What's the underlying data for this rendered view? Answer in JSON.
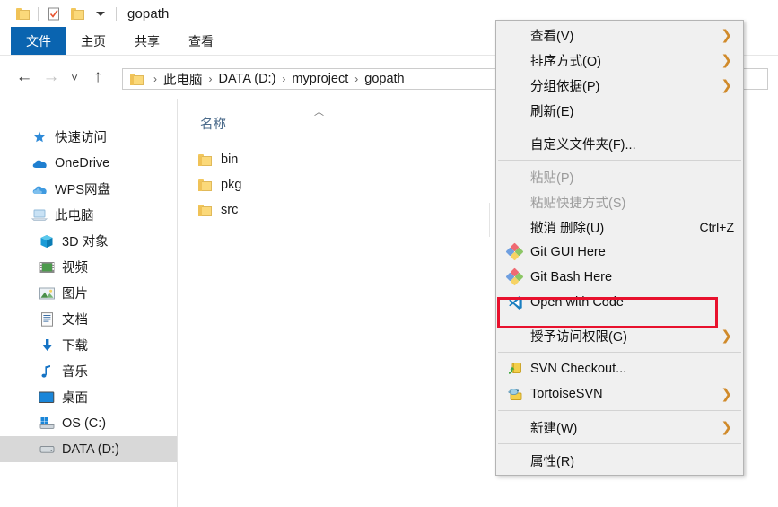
{
  "window": {
    "title": "gopath",
    "quick_access": [
      {
        "name": "folder-icon",
        "label": "folder"
      },
      {
        "name": "properties-icon",
        "label": "properties"
      },
      {
        "name": "new-folder-icon",
        "label": "new folder"
      },
      {
        "name": "customize-dropdown",
        "label": "customize quick access toolbar"
      }
    ]
  },
  "ribbon": {
    "tabs": [
      {
        "label": "文件",
        "active": true
      },
      {
        "label": "主页",
        "active": false
      },
      {
        "label": "共享",
        "active": false
      },
      {
        "label": "查看",
        "active": false
      }
    ],
    "active_color": "#0a64b0"
  },
  "navigation": {
    "back": "←",
    "forward": "→",
    "recent": "˅",
    "up": "↑",
    "breadcrumb": [
      "此电脑",
      "DATA (D:)",
      "myproject",
      "gopath"
    ],
    "separator": "›"
  },
  "sidebar": {
    "items": [
      {
        "label": "快速访问",
        "icon": "star-icon",
        "indent": false,
        "selected": false
      },
      {
        "label": "OneDrive",
        "icon": "cloud-icon",
        "indent": false,
        "selected": false
      },
      {
        "label": "WPS网盘",
        "icon": "cloud-icon",
        "indent": false,
        "selected": false
      },
      {
        "label": "此电脑",
        "icon": "computer-icon",
        "indent": false,
        "selected": false
      },
      {
        "label": "3D 对象",
        "icon": "3d-objects-icon",
        "indent": true,
        "selected": false
      },
      {
        "label": "视频",
        "icon": "videos-icon",
        "indent": true,
        "selected": false
      },
      {
        "label": "图片",
        "icon": "pictures-icon",
        "indent": true,
        "selected": false
      },
      {
        "label": "文档",
        "icon": "documents-icon",
        "indent": true,
        "selected": false
      },
      {
        "label": "下载",
        "icon": "downloads-icon",
        "indent": true,
        "selected": false
      },
      {
        "label": "音乐",
        "icon": "music-icon",
        "indent": true,
        "selected": false
      },
      {
        "label": "桌面",
        "icon": "desktop-icon",
        "indent": true,
        "selected": false
      },
      {
        "label": "OS (C:)",
        "icon": "drive-os-icon",
        "indent": true,
        "selected": false
      },
      {
        "label": "DATA (D:)",
        "icon": "drive-icon",
        "indent": true,
        "selected": true
      }
    ]
  },
  "filelist": {
    "sort_caret": "︿",
    "columns": [
      "名称"
    ],
    "rows": [
      {
        "name": "bin",
        "icon": "folder-icon"
      },
      {
        "name": "pkg",
        "icon": "folder-icon"
      },
      {
        "name": "src",
        "icon": "folder-icon"
      }
    ]
  },
  "context_menu": {
    "highlight_color": "#e8112d",
    "items": [
      {
        "label": "查看(V)",
        "icon": null,
        "submenu": true,
        "disabled": false,
        "accel": "",
        "separator_after": false
      },
      {
        "label": "排序方式(O)",
        "icon": null,
        "submenu": true,
        "disabled": false,
        "accel": "",
        "separator_after": false
      },
      {
        "label": "分组依据(P)",
        "icon": null,
        "submenu": true,
        "disabled": false,
        "accel": "",
        "separator_after": false
      },
      {
        "label": "刷新(E)",
        "icon": null,
        "submenu": false,
        "disabled": false,
        "accel": "",
        "separator_after": true
      },
      {
        "label": "自定义文件夹(F)...",
        "icon": null,
        "submenu": false,
        "disabled": false,
        "accel": "",
        "separator_after": true
      },
      {
        "label": "粘贴(P)",
        "icon": null,
        "submenu": false,
        "disabled": true,
        "accel": "",
        "separator_after": false
      },
      {
        "label": "粘贴快捷方式(S)",
        "icon": null,
        "submenu": false,
        "disabled": true,
        "accel": "",
        "separator_after": false
      },
      {
        "label": "撤消 删除(U)",
        "icon": null,
        "submenu": false,
        "disabled": false,
        "accel": "Ctrl+Z",
        "separator_after": false
      },
      {
        "label": "Git GUI Here",
        "icon": "git-icon",
        "submenu": false,
        "disabled": false,
        "accel": "",
        "separator_after": false
      },
      {
        "label": "Git Bash Here",
        "icon": "git-icon",
        "submenu": false,
        "disabled": false,
        "accel": "",
        "separator_after": false
      },
      {
        "label": "Open with Code",
        "icon": "vscode-icon",
        "submenu": false,
        "disabled": false,
        "accel": "",
        "separator_after": true,
        "highlighted": true
      },
      {
        "label": "授予访问权限(G)",
        "icon": null,
        "submenu": true,
        "disabled": false,
        "accel": "",
        "separator_after": true
      },
      {
        "label": "SVN Checkout...",
        "icon": "svn-checkout-icon",
        "submenu": false,
        "disabled": false,
        "accel": "",
        "separator_after": false
      },
      {
        "label": "TortoiseSVN",
        "icon": "tortoisesvn-icon",
        "submenu": true,
        "disabled": false,
        "accel": "",
        "separator_after": true
      },
      {
        "label": "新建(W)",
        "icon": null,
        "submenu": true,
        "disabled": false,
        "accel": "",
        "separator_after": true
      },
      {
        "label": "属性(R)",
        "icon": null,
        "submenu": false,
        "disabled": false,
        "accel": "",
        "separator_after": false
      }
    ]
  }
}
